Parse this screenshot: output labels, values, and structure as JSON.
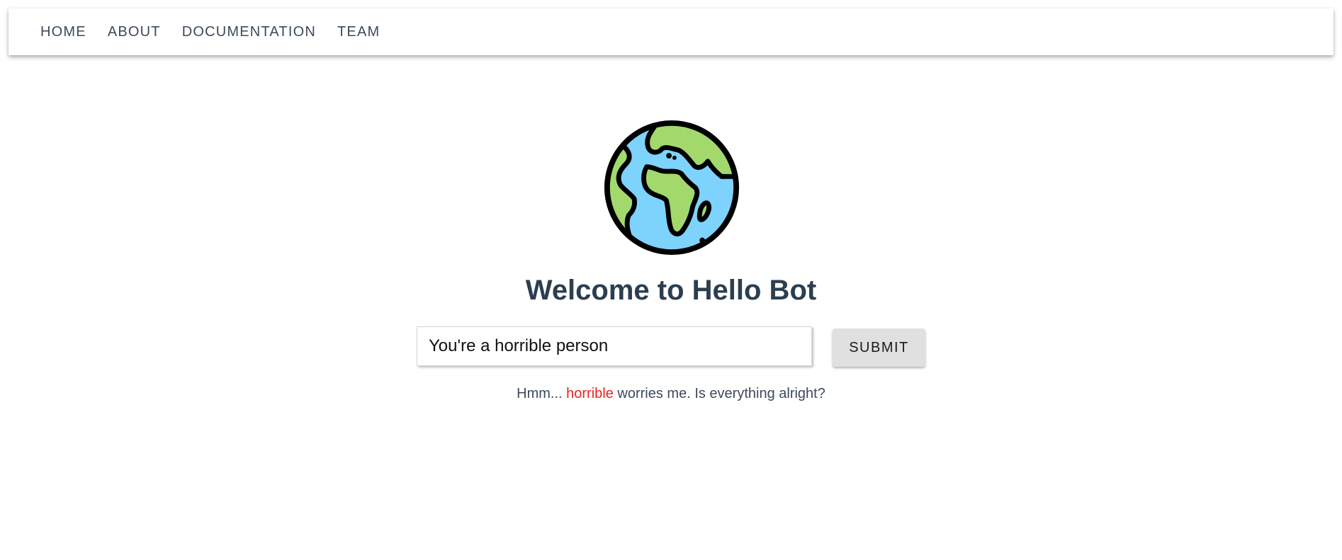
{
  "nav": {
    "items": [
      {
        "label": "HOME"
      },
      {
        "label": "ABOUT"
      },
      {
        "label": "DOCUMENTATION"
      },
      {
        "label": "TEAM"
      }
    ]
  },
  "hero": {
    "logo_icon": "globe-icon",
    "title": "Welcome to Hello Bot"
  },
  "form": {
    "input_value": "You're a horrible person",
    "submit_label": "SUBMIT"
  },
  "response": {
    "prefix": "Hmm...",
    "flagged_word": "horrible",
    "suffix": "worries me. Is everything alright?"
  },
  "colors": {
    "text": "#2c3e50",
    "flagged": "#e8231f",
    "globe_ocean": "#7dd3fc",
    "globe_land": "#a3d96c",
    "button_bg": "#e0e0e0"
  }
}
